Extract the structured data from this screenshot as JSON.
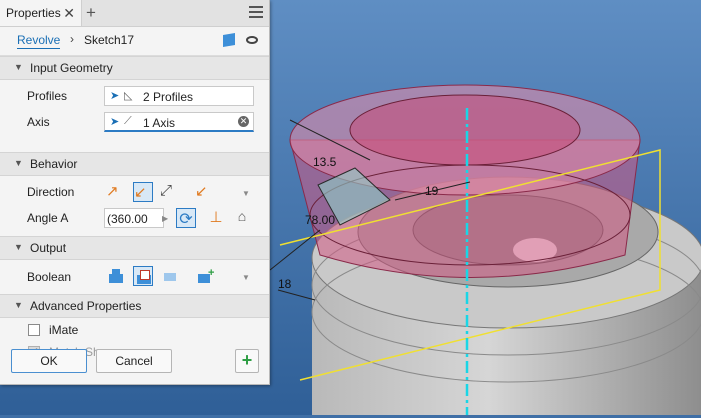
{
  "panel": {
    "tab_title": "Properties",
    "close_glyph": "✕",
    "add_tab_glyph": "+",
    "breadcrumb": {
      "feature": "Revolve",
      "separator": "›",
      "sketch": "Sketch17"
    }
  },
  "sections": {
    "input_geometry": "Input Geometry",
    "behavior": "Behavior",
    "output": "Output",
    "advanced": "Advanced Properties"
  },
  "input_geometry": {
    "profiles_label": "Profiles",
    "profiles_value": "2 Profiles",
    "axis_label": "Axis",
    "axis_value": "1 Axis"
  },
  "behavior": {
    "direction_label": "Direction",
    "angle_label": "Angle A",
    "angle_value": "(360.00"
  },
  "output": {
    "boolean_label": "Boolean"
  },
  "advanced": {
    "imate_label": "iMate",
    "imate_checked": false,
    "match_shape_label": "Match Shape",
    "match_shape_checked": true
  },
  "footer": {
    "ok_label": "OK",
    "cancel_label": "Cancel"
  },
  "canvas": {
    "dims": [
      "13.5",
      "19",
      "78.00",
      "18"
    ],
    "colors": {
      "background": "#3f6fa6",
      "preview": "#d25a84",
      "axis": "#19d6e6",
      "frame": "#f0e030",
      "accent": "#1a6fb5"
    }
  }
}
